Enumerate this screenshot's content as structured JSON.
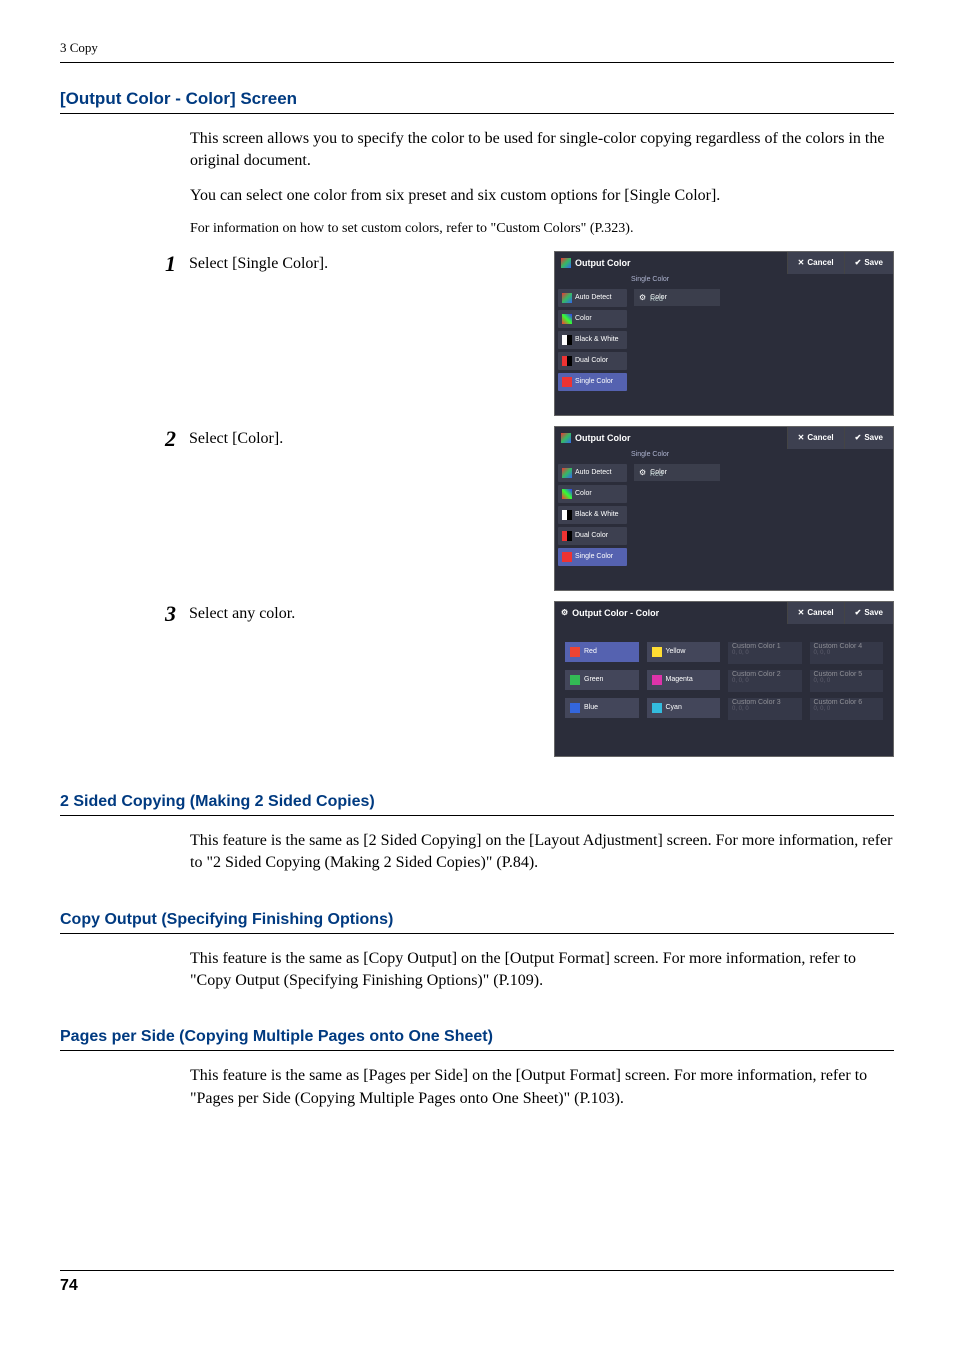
{
  "header": {
    "breadcrumb": "3 Copy"
  },
  "section_output_color": {
    "title": "[Output Color - Color] Screen",
    "p1": "This screen allows you to specify the color to be used for single-color copying regardless of the colors in the original document.",
    "p2": "You can select one color from six preset and six custom options for [Single Color].",
    "p3": "For information on how to set custom colors, refer to \"Custom Colors\" (P.323)."
  },
  "steps": {
    "s1": {
      "num": "1",
      "text": "Select [Single Color]."
    },
    "s2": {
      "num": "2",
      "text": "Select [Color]."
    },
    "s3": {
      "num": "3",
      "text": "Select any color."
    }
  },
  "screen_common": {
    "cancel": "Cancel",
    "save": "Save"
  },
  "screen_output_color": {
    "title": "Output Color",
    "subheading": "Single Color",
    "chip_label": "Color",
    "chip_value": "Red",
    "sidebar": {
      "auto": "Auto Detect",
      "color": "Color",
      "bw": "Black & White",
      "dual": "Dual Color",
      "single": "Single Color"
    }
  },
  "screen_color_picker": {
    "title": "Output Color - Color",
    "colors": {
      "red": "Red",
      "green": "Green",
      "blue": "Blue",
      "yellow": "Yellow",
      "magenta": "Magenta",
      "cyan": "Cyan",
      "c1": "Custom Color 1",
      "c1v": "0, 0, 0",
      "c2": "Custom Color 2",
      "c2v": "0, 0, 0",
      "c3": "Custom Color 3",
      "c3v": "0, 0, 0",
      "c4": "Custom Color 4",
      "c4v": "0, 0, 0",
      "c5": "Custom Color 5",
      "c5v": "0, 0, 0",
      "c6": "Custom Color 6",
      "c6v": "0, 0, 0"
    }
  },
  "section_2sided": {
    "title": "2 Sided Copying (Making 2 Sided Copies)",
    "body": "This feature is the same as [2 Sided Copying] on the [Layout Adjustment] screen. For more information, refer to \"2 Sided Copying (Making 2 Sided Copies)\" (P.84)."
  },
  "section_copy_output": {
    "title": "Copy Output (Specifying Finishing Options)",
    "body": "This feature is the same as [Copy Output] on the [Output Format] screen. For more information, refer to \"Copy Output (Specifying Finishing Options)\" (P.109)."
  },
  "section_pages": {
    "title": "Pages per Side (Copying Multiple Pages onto One Sheet)",
    "body": "This feature is the same as [Pages per Side] on the [Output Format] screen. For more information, refer to \"Pages per Side (Copying Multiple Pages onto One Sheet)\" (P.103)."
  },
  "footer": {
    "page": "74"
  }
}
